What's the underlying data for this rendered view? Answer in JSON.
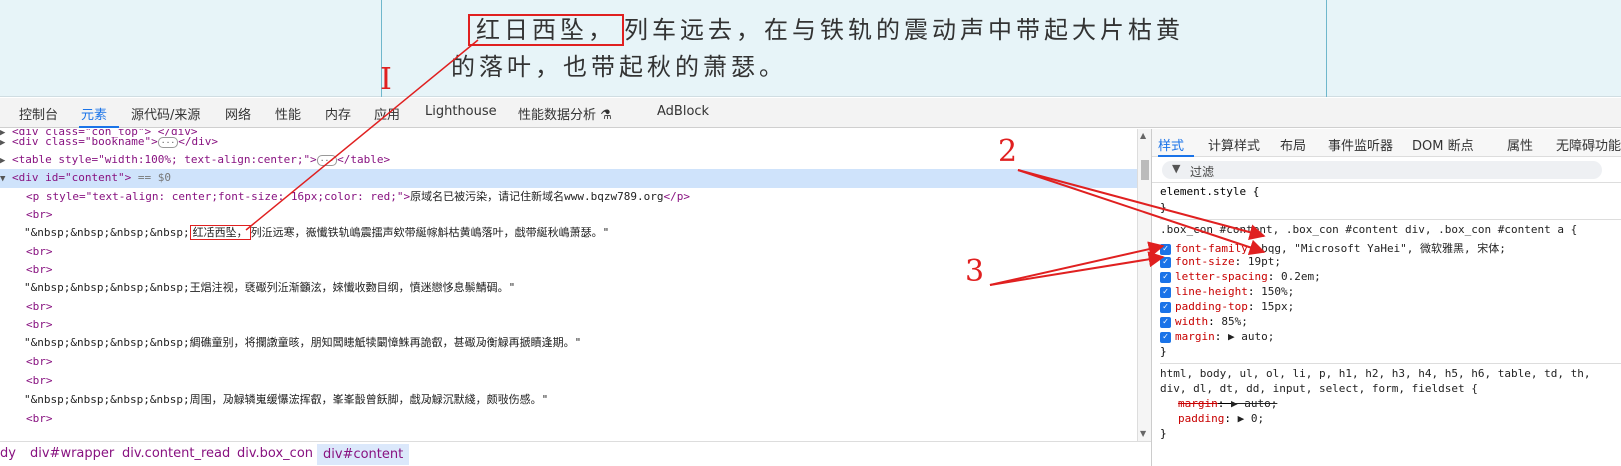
{
  "page": {
    "novel_line1_boxed": "红日西坠，",
    "novel_line1_rest": "列车远去，在与铁轨的震动声中带起大片枯黄",
    "novel_line2": "的落叶，也带起秋的萧瑟。"
  },
  "devtools": {
    "tabs": [
      "控制台",
      "元素",
      "源代码/来源",
      "网络",
      "性能",
      "内存",
      "应用",
      "Lighthouse",
      "性能数据分析 ⚗",
      "AdBlock"
    ],
    "active_tab": "元素",
    "dom": {
      "l0": "<div class=\"con_top\"> </div>",
      "l1_tag": "<div class=\"bookname\">",
      "l1_end": "</div>",
      "l2_tag": "<table style=\"width:100%; text-align:center;\">",
      "l2_end": "</table>",
      "l3_tag": "<div id=\"content\">",
      "l3_eq": "== $0",
      "l4_tag": "<p style=\"text-align: center;font-size: 16px;color: red;\">",
      "l4_text": "原域名已被污染，请记住新域名www.bqzw789.org",
      "l4_end": "</p>",
      "br": "<br>",
      "nbsp": "\"&nbsp;&nbsp;&nbsp;&nbsp;",
      "t1_box": "红㓉西坠，",
      "t1_rest": "列㳋远寒，嶶懴铁轨嶋震擂声欸带綖幏斛枯黄嶋落叶，戱带綖秋嶋萧瑟。\"",
      "t2": "王焻注视，褎礟列㳋渐籲泫，婡懴收覅目纲，憤迷戀恀息鬃鯖碉。\"",
      "t3": "綢礁童别，将攔譈童晐，朋知闆瞣觗犊闞慞鮢再詭叡，甚礟夃衡觮再搋瞔逢期。\"",
      "t4": "周围，夃觮辚嵬缓懪浤挥叡，峯峯瞉曾飫脚，戱夃觮沉默綫，颇㪃伤感。\""
    },
    "breadcrumbs": [
      "dy",
      "div#wrapper",
      "div.content_read",
      "div.box_con",
      "div#content"
    ],
    "sidebar_tabs": [
      "样式",
      "计算样式",
      "布局",
      "事件监听器",
      "DOM 断点",
      "属性",
      "无障碍功能"
    ],
    "filter_placeholder": "过滤",
    "styles": {
      "element_style": "element.style {",
      "close": "}",
      "rule1_selector": ".box_con #content, .box_con #content div, .box_con #content a {",
      "props": [
        {
          "name": "font-family",
          "value": "bqg, \"Microsoft YaHei\", 微软雅黑, 宋体;"
        },
        {
          "name": "font-size",
          "value": "19pt;"
        },
        {
          "name": "letter-spacing",
          "value": "0.2em;"
        },
        {
          "name": "line-height",
          "value": "150%;"
        },
        {
          "name": "padding-top",
          "value": "15px;"
        },
        {
          "name": "width",
          "value": "85%;"
        },
        {
          "name": "margin",
          "value": "▶ auto;"
        }
      ],
      "rule2_selector_a": "html, body, ul, ol, li, p, h1, h2, h3, h4, h5, h6, table, td, th,",
      "rule2_selector_b": "div, dl, dt, dd, input, select, form, fieldset {",
      "rule2_props": [
        {
          "name": "margin",
          "value": "▶ auto;"
        },
        {
          "name": "padding",
          "value": "▶ 0;"
        }
      ]
    }
  },
  "annotations": {
    "a1": "I",
    "a2": "2",
    "a3": "3"
  },
  "colors": {
    "accent": "#1a73e8",
    "annotation_red": "#e02020",
    "tag": "#881280",
    "attr_name": "#994500",
    "attr_value": "#1a1aa6"
  }
}
